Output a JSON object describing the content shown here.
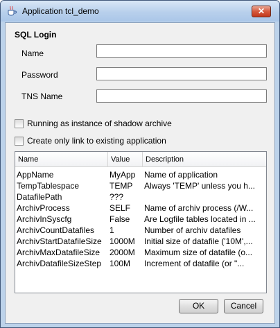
{
  "window": {
    "title": "Application tcl_demo",
    "close_label": "✕"
  },
  "login": {
    "title": "SQL Login",
    "fields": [
      {
        "label": "Name",
        "value": ""
      },
      {
        "label": "Password",
        "value": ""
      },
      {
        "label": "TNS Name",
        "value": ""
      }
    ]
  },
  "options": [
    {
      "label": "Running as instance of shadow archive",
      "checked": false
    },
    {
      "label": "Create only link to existing application",
      "checked": false
    }
  ],
  "table": {
    "columns": [
      "Name",
      "Value",
      "Description"
    ],
    "rows": [
      [
        "AppName",
        "MyApp",
        "Name of application"
      ],
      [
        "TempTablespace",
        "TEMP",
        "Always 'TEMP' unless you h..."
      ],
      [
        "DatafilePath",
        "???",
        ""
      ],
      [
        "ArchivProcess",
        "SELF",
        "Name of archiv process (/W..."
      ],
      [
        "ArchivInSyscfg",
        "False",
        "Are Logfile tables located in ..."
      ],
      [
        "ArchivCountDatafiles",
        "1",
        "Number of archiv datafiles"
      ],
      [
        "ArchivStartDatafileSize",
        "1000M",
        "Initial size of datafile ('10M',..."
      ],
      [
        "ArchivMaxDatafileSize",
        "2000M",
        "Maximum size of datafile (o..."
      ],
      [
        "ArchivDatafileSizeStep",
        "100M",
        "Increment of datafile    (or \"..."
      ]
    ]
  },
  "buttons": {
    "ok": "OK",
    "cancel": "Cancel"
  },
  "icons": {
    "app": "java-cup-icon",
    "close": "close-icon"
  },
  "colors": {
    "close_button": "#d5593d",
    "titlebar": "#b8d0ec"
  }
}
